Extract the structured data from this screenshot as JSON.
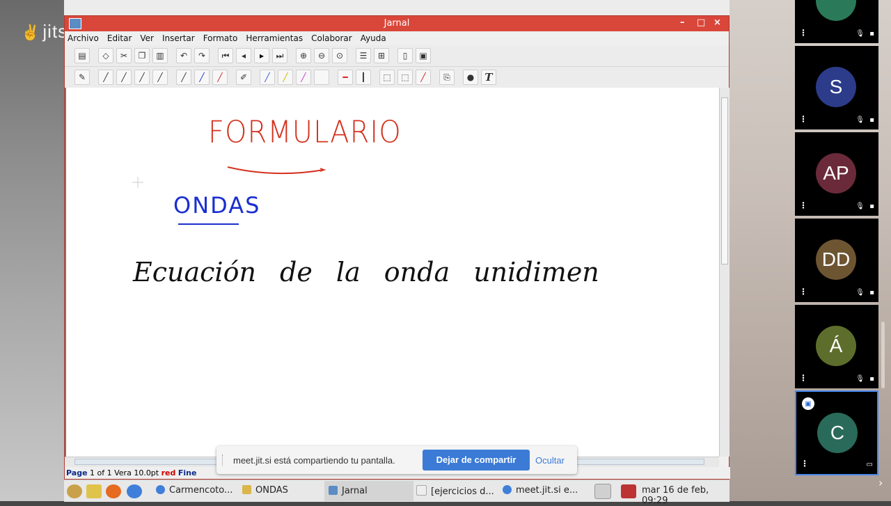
{
  "meet": {
    "logo": "jitsi"
  },
  "window": {
    "title": "Jarnal",
    "controls": {
      "minimize": "–",
      "maximize": "□",
      "close": "×"
    }
  },
  "menu": [
    "Archivo",
    "Editar",
    "Ver",
    "Insertar",
    "Formato",
    "Herramientas",
    "Colaborar",
    "Ayuda"
  ],
  "toolbar1_icons": [
    "save-icon",
    "eraser-icon",
    "cut-icon",
    "copy-icon",
    "paste-icon",
    "undo-icon",
    "redo-icon",
    "first-page-icon",
    "prev-page-icon",
    "next-page-icon",
    "last-page-icon",
    "zoom-in-icon",
    "zoom-out-icon",
    "zoom-fit-icon",
    "layout-icon",
    "grid-icon",
    "new-page-icon",
    "image-icon"
  ],
  "toolbar2_icons": [
    "pen-icon",
    "fine-pen-icon",
    "medium-pen-icon",
    "thick-pen-icon",
    "heavy-pen-icon",
    "black-pen-icon",
    "blue-pen-icon",
    "red-pen-icon",
    "pencil-icon",
    "highlighter-blue-icon",
    "highlighter-yellow-icon",
    "highlighter-pink-icon",
    "white-icon",
    "line-red-icon",
    "line-black-icon",
    "select-icon",
    "select-alt-icon",
    "eraser-red-icon",
    "clip-icon",
    "stamp-icon",
    "text-icon"
  ],
  "canvas": {
    "heading": "FORMULARIO",
    "subheading": "ONDAS",
    "line1": "Ecuación de la onda unidimen"
  },
  "status": {
    "page_label": "Page",
    "page_info": "1 of 1 Vera 10.0pt",
    "color": "red",
    "weight": "Fine"
  },
  "share_notice": {
    "message": "meet.jit.si está compartiendo tu pantalla.",
    "stop_label": "Dejar de compartir",
    "hide_label": "Ocultar"
  },
  "taskbar": {
    "tasks": [
      "Carmencoto...",
      "ONDAS",
      "Jarnal",
      "[ejercicios d...",
      "meet.jit.si e..."
    ],
    "clock": "mar 16 de feb, 09:29"
  },
  "participants": [
    {
      "initials": "",
      "color": "#2a7a5a"
    },
    {
      "initials": "S",
      "color": "#2c3c8a"
    },
    {
      "initials": "AP",
      "color": "#6b2a3a"
    },
    {
      "initials": "DD",
      "color": "#6e5532"
    },
    {
      "initials": "Á",
      "color": "#5d6e2c"
    },
    {
      "initials": "C",
      "color": "#2a6a5a"
    }
  ]
}
